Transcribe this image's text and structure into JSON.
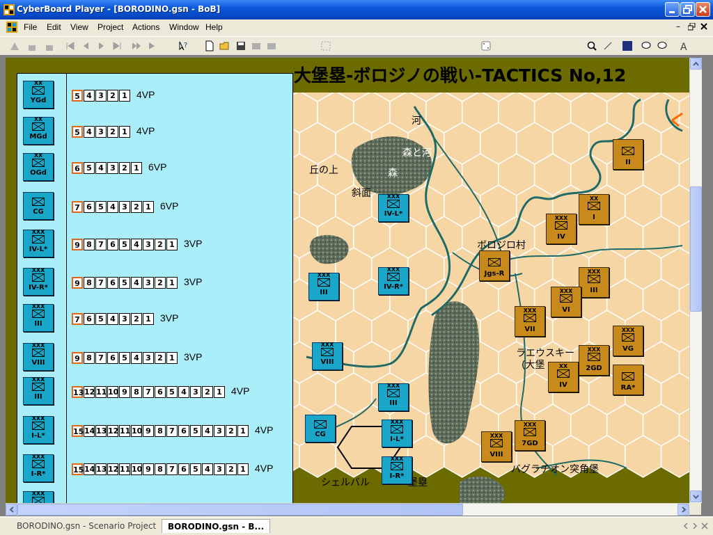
{
  "window": {
    "title": "CyberBoard Player - [BORODINO.gsn - BoB]"
  },
  "menu": [
    "File",
    "Edit",
    "View",
    "Project",
    "Actions",
    "Window",
    "Help"
  ],
  "map": {
    "title": "大堡塁-ボロジノの戦い-TACTICS No,12",
    "labels": [
      "河",
      "森と河",
      "丘の上",
      "森",
      "斜面",
      "ボロジロ村",
      "ラエウスキー",
      "(大堡",
      "シェルバル",
      "堡塁",
      "バグラチオン突角堡"
    ]
  },
  "tray": {
    "counters": [
      {
        "size": "XX",
        "label": "YGd"
      },
      {
        "size": "XX",
        "label": "MGd"
      },
      {
        "size": "XX",
        "label": "OGd"
      },
      {
        "size": "",
        "label": "CG"
      },
      {
        "size": "XXX",
        "label": "IV-L*"
      },
      {
        "size": "XXX",
        "label": "IV-R*"
      },
      {
        "size": "XXX",
        "label": "III"
      },
      {
        "size": "XXX",
        "label": "VIII"
      },
      {
        "size": "XXX",
        "label": "III"
      },
      {
        "size": "XXX",
        "label": "I-L*"
      },
      {
        "size": "XXX",
        "label": "I-R*"
      },
      {
        "size": "XXX",
        "label": ""
      }
    ],
    "tracks": [
      {
        "cells": [
          "5",
          "4",
          "3",
          "2",
          "1"
        ],
        "vp": "4VP"
      },
      {
        "cells": [
          "5",
          "4",
          "3",
          "2",
          "1"
        ],
        "vp": "4VP"
      },
      {
        "cells": [
          "6",
          "5",
          "4",
          "3",
          "2",
          "1"
        ],
        "vp": "6VP"
      },
      {
        "cells": [
          "7",
          "6",
          "5",
          "4",
          "3",
          "2",
          "1"
        ],
        "vp": "6VP"
      },
      {
        "cells": [
          "9",
          "8",
          "7",
          "6",
          "5",
          "4",
          "3",
          "2",
          "1"
        ],
        "vp": "3VP"
      },
      {
        "cells": [
          "9",
          "8",
          "7",
          "6",
          "5",
          "4",
          "3",
          "2",
          "1"
        ],
        "vp": "3VP"
      },
      {
        "cells": [
          "7",
          "6",
          "5",
          "4",
          "3",
          "2",
          "1"
        ],
        "vp": "3VP"
      },
      {
        "cells": [
          "9",
          "8",
          "7",
          "6",
          "5",
          "4",
          "3",
          "2",
          "1"
        ],
        "vp": "3VP"
      },
      {
        "cells": [
          "13",
          "12",
          "11",
          "10",
          "9",
          "8",
          "7",
          "6",
          "5",
          "4",
          "3",
          "2",
          "1"
        ],
        "vp": "4VP"
      },
      {
        "cells": [
          "15",
          "14",
          "13",
          "12",
          "11",
          "10",
          "9",
          "8",
          "7",
          "6",
          "5",
          "4",
          "3",
          "2",
          "1"
        ],
        "vp": "4VP"
      },
      {
        "cells": [
          "15",
          "14",
          "13",
          "12",
          "11",
          "10",
          "9",
          "8",
          "7",
          "6",
          "5",
          "4",
          "3",
          "2",
          "1"
        ],
        "vp": "4VP"
      }
    ]
  },
  "map_units": {
    "russian": [
      {
        "size": "XXX",
        "label": "IV-L*"
      },
      {
        "size": "XXX",
        "label": "III"
      },
      {
        "size": "XXX",
        "label": "IV-R*"
      },
      {
        "size": "XXX",
        "label": "VIII"
      },
      {
        "size": "",
        "label": "CG"
      },
      {
        "size": "XXX",
        "label": "III"
      },
      {
        "size": "XXX",
        "label": "I-L*"
      },
      {
        "size": "XXX",
        "label": "I-R*"
      }
    ],
    "french": [
      {
        "size": "",
        "label": "II"
      },
      {
        "size": "XX",
        "label": "I"
      },
      {
        "size": "XXX",
        "label": "IV"
      },
      {
        "size": "",
        "label": "Jgs-R"
      },
      {
        "size": "XXX",
        "label": "III"
      },
      {
        "size": "XXX",
        "label": "VI"
      },
      {
        "size": "XXX",
        "label": "VII"
      },
      {
        "size": "XXX",
        "label": "VG"
      },
      {
        "size": "XXX",
        "label": "2GD"
      },
      {
        "size": "XX",
        "label": "IV"
      },
      {
        "size": "",
        "label": "RA*"
      },
      {
        "size": "XXX",
        "label": "VIII"
      },
      {
        "size": "XXX",
        "label": "7GD"
      }
    ]
  },
  "tabs": [
    "BORODINO.gsn - Scenario Project",
    "BORODINO.gsn - B..."
  ],
  "colors": {
    "russian": "#1aa6c8",
    "french": "#c88a1a",
    "tray": "#a9eef8",
    "hexfill": "#f7d6a5",
    "forest": "#5a6a5a",
    "river": "#1d6a66"
  }
}
